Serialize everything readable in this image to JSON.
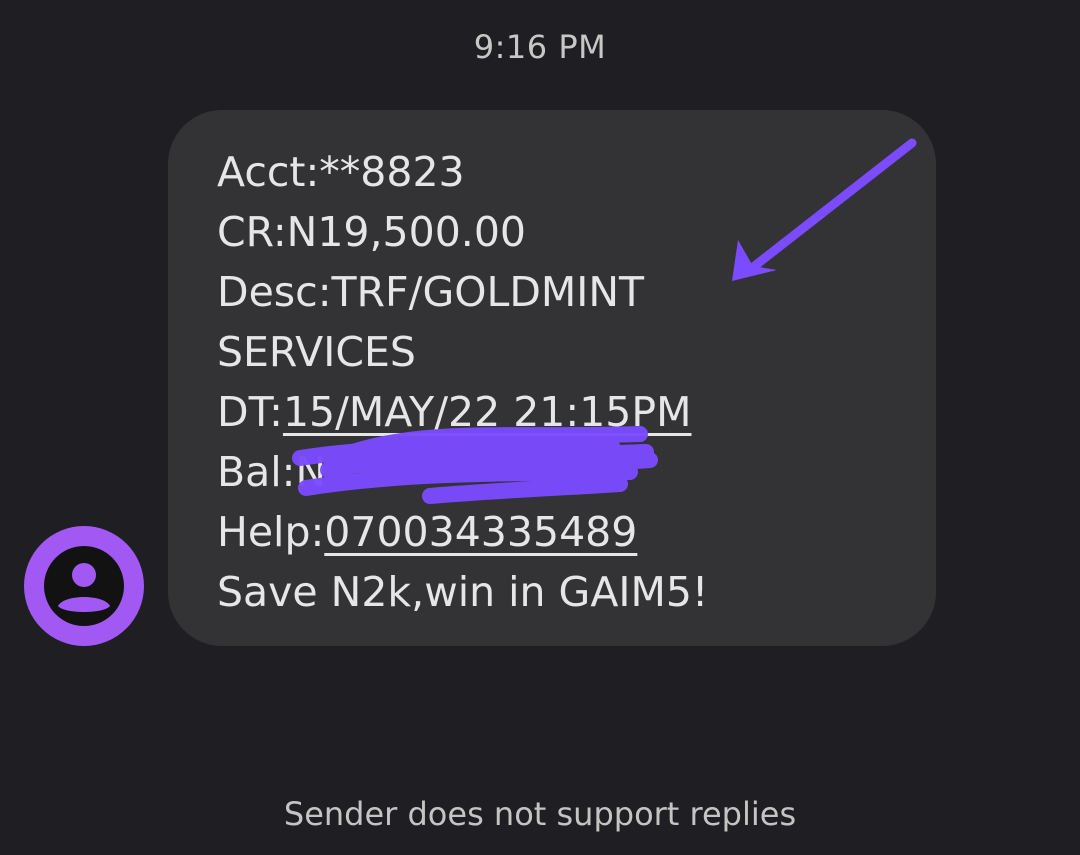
{
  "conversation": {
    "timestamp": "9:16 PM",
    "message": {
      "acct": "Acct:**8823",
      "cr": "CR:N19,500.00",
      "desc_line1": "Desc:TRF/GOLDMINT",
      "desc_line2": "SERVICES",
      "dt_prefix": "DT:",
      "dt_value": "15/MAY/22 21:15PM",
      "bal_prefix": "Bal:N",
      "help_prefix": "Help:",
      "help_number": "070034335489",
      "promo": "Save N2k,win in GAIM5!"
    },
    "footer": "Sender does not support replies"
  },
  "colors": {
    "background": "#1f1f23",
    "bubble": "#333336",
    "avatar": "#a259f4",
    "annotation": "#7b4bff"
  },
  "icons": {
    "avatar": "person-icon",
    "annotation_arrow": "arrow-icon",
    "redaction": "scribble-redaction"
  }
}
